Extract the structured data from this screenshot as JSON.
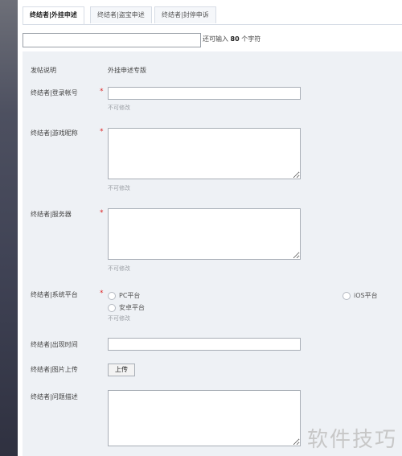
{
  "tabs": [
    {
      "label": "终结者|外挂申述"
    },
    {
      "label": "终结者|盗宝申述"
    },
    {
      "label": "终结者|封停申诉"
    }
  ],
  "top": {
    "input_value": "",
    "hint_prefix": "还可输入",
    "hint_count": "80",
    "hint_suffix": "个字符"
  },
  "form": {
    "desc_label": "发帖说明",
    "desc_value": "外挂申述专版",
    "account_label": "终结者|登录帐号",
    "nickname_label": "终结者|游戏昵称",
    "server_label": "终结者|服务器",
    "platform_label": "终结者|系统平台",
    "time_label": "终结者|出现时间",
    "image_label": "终结者|图片上传",
    "issue_label": "终结者|问题描述",
    "not_editable": "不可修改",
    "required_mark": "*",
    "platform_options": [
      {
        "label": "PC平台"
      },
      {
        "label": "iOS平台"
      },
      {
        "label": "安卓平台"
      }
    ],
    "upload_label": "上传"
  },
  "watermark": "软件技巧"
}
